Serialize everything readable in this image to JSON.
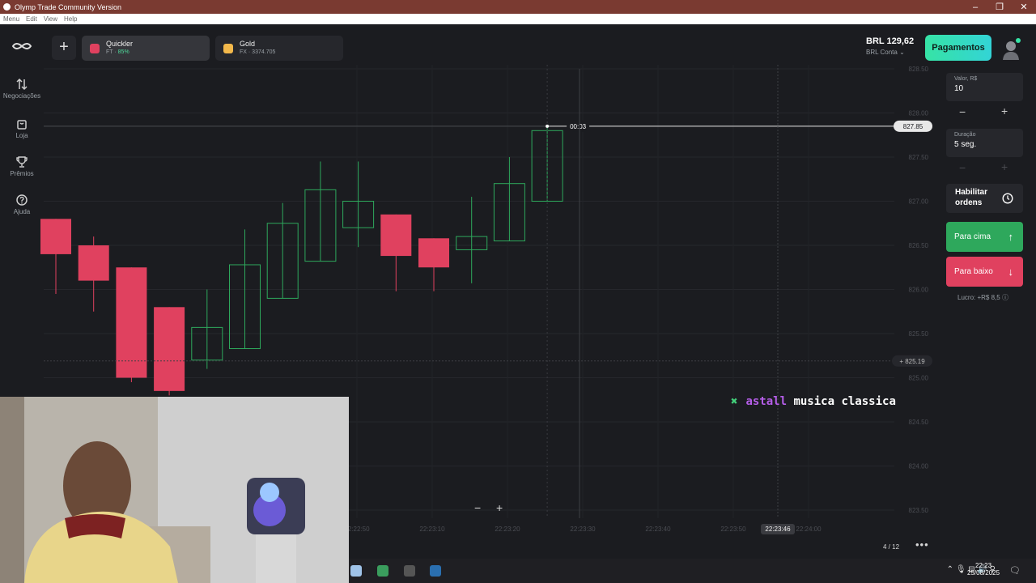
{
  "window": {
    "title": "Olymp Trade Community Version",
    "menu": [
      "Menu",
      "Edit",
      "View",
      "Help"
    ],
    "controls": [
      "–",
      "❐",
      "✕"
    ]
  },
  "sidebar": {
    "items": [
      {
        "label": "Negociações",
        "icon": "arrows-updown-icon"
      },
      {
        "label": "Loja",
        "icon": "bag-icon"
      },
      {
        "label": "Prêmios",
        "icon": "trophy-icon"
      },
      {
        "label": "Ajuda",
        "icon": "help-icon"
      }
    ]
  },
  "tabs": [
    {
      "name": "Quickler",
      "sub_prefix": "FT · ",
      "sub_value": "85%",
      "color": "#e0415f",
      "active": true
    },
    {
      "name": "Gold",
      "sub_prefix": "FX · ",
      "sub_value": "3374.705",
      "color": "#f2b84b",
      "active": false
    }
  ],
  "header": {
    "balance": "BRL 129,62",
    "account": "BRL Conta",
    "pay_button": "Pagamentos"
  },
  "chart": {
    "timer": "00:03",
    "current_price": "827.85",
    "line_price": "825.19",
    "y_ticks": [
      "828.50",
      "828.00",
      "827.50",
      "827.00",
      "826.50",
      "826.00",
      "825.50",
      "825.00",
      "824.50",
      "824.00",
      "823.50"
    ],
    "x_ticks": [
      "22:22:50",
      "22:23:10",
      "22:23:20",
      "22:23:30",
      "22:23:40",
      "22:23:50",
      "22:24:00"
    ],
    "crosshair_time": "22:23:46",
    "candles": [
      {
        "o": 826.4,
        "c": 826.8,
        "h": 826.8,
        "l": 825.95,
        "dir": "down"
      },
      {
        "o": 826.5,
        "c": 826.1,
        "h": 826.6,
        "l": 825.75,
        "dir": "down"
      },
      {
        "o": 826.25,
        "c": 825.0,
        "h": 826.25,
        "l": 824.95,
        "dir": "down"
      },
      {
        "o": 825.8,
        "c": 824.85,
        "h": 825.8,
        "l": 824.8,
        "dir": "down"
      },
      {
        "o": 825.2,
        "c": 825.57,
        "h": 826.0,
        "l": 825.1,
        "dir": "up"
      },
      {
        "o": 825.33,
        "c": 826.28,
        "h": 826.68,
        "l": 825.33,
        "dir": "up"
      },
      {
        "o": 825.9,
        "c": 826.75,
        "h": 826.98,
        "l": 825.9,
        "dir": "up"
      },
      {
        "o": 826.32,
        "c": 827.13,
        "h": 827.45,
        "l": 826.32,
        "dir": "up"
      },
      {
        "o": 826.7,
        "c": 827.0,
        "h": 827.45,
        "l": 826.48,
        "dir": "up"
      },
      {
        "o": 826.85,
        "c": 826.38,
        "h": 826.85,
        "l": 825.98,
        "dir": "down"
      },
      {
        "o": 826.58,
        "c": 826.25,
        "h": 826.58,
        "l": 825.98,
        "dir": "down"
      },
      {
        "o": 826.45,
        "c": 826.6,
        "h": 827.05,
        "l": 826.07,
        "dir": "up"
      },
      {
        "o": 826.55,
        "c": 827.2,
        "h": 827.5,
        "l": 826.55,
        "dir": "up"
      },
      {
        "o": 827.0,
        "c": 827.8,
        "h": 827.85,
        "l": 827.0,
        "dir": "up"
      }
    ]
  },
  "panel": {
    "amount_label": "Valor, R$",
    "amount_value": "10",
    "duration_label": "Duração",
    "duration_value": "5 seg.",
    "orders_label": "Habilitar ordens",
    "up_label": "Para cima",
    "down_label": "Para baixo",
    "profit": "Lucro: +R$ 8,5"
  },
  "overlay": {
    "x": "✖",
    "highlight": "astall",
    "rest": " musica classica"
  },
  "footer": {
    "page": "4 / 12",
    "more": "•••",
    "zoom_out": "−",
    "zoom_in": "+"
  },
  "taskbar": {
    "time": "22:23",
    "date": "25/08/2025"
  },
  "colors": {
    "up": "#2ea85c",
    "down": "#e0415f",
    "accent": "#36e3a5"
  }
}
